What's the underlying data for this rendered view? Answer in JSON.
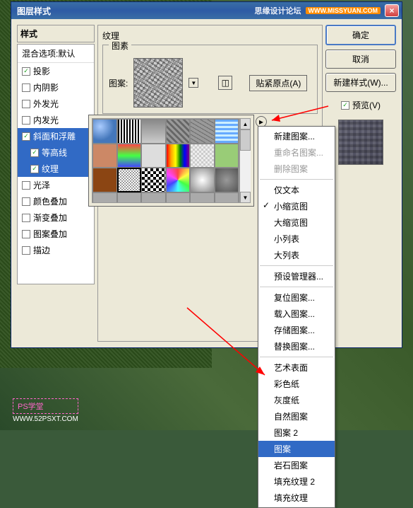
{
  "titlebar": {
    "title": "图层样式",
    "watermark_text": "思缘设计论坛",
    "watermark_url": "WWW.MISSYUAN.COM",
    "close": "×"
  },
  "styles_panel": {
    "header": "样式",
    "blend_label": "混合选项:默认",
    "items": [
      {
        "label": "投影",
        "checked": true,
        "selected": false,
        "sub": false
      },
      {
        "label": "内阴影",
        "checked": false,
        "selected": false,
        "sub": false
      },
      {
        "label": "外发光",
        "checked": false,
        "selected": false,
        "sub": false
      },
      {
        "label": "内发光",
        "checked": false,
        "selected": false,
        "sub": false
      },
      {
        "label": "斜面和浮雕",
        "checked": true,
        "selected": true,
        "sub": false
      },
      {
        "label": "等高线",
        "checked": true,
        "selected": true,
        "sub": true
      },
      {
        "label": "纹理",
        "checked": true,
        "selected": true,
        "sub": true
      },
      {
        "label": "光泽",
        "checked": false,
        "selected": false,
        "sub": false
      },
      {
        "label": "颜色叠加",
        "checked": false,
        "selected": false,
        "sub": false
      },
      {
        "label": "渐变叠加",
        "checked": false,
        "selected": false,
        "sub": false
      },
      {
        "label": "图案叠加",
        "checked": false,
        "selected": false,
        "sub": false
      },
      {
        "label": "描边",
        "checked": false,
        "selected": false,
        "sub": false
      }
    ]
  },
  "middle": {
    "section_label": "纹理",
    "fieldset_label": "图素",
    "pattern_label": "图案:",
    "snap_btn": "贴紧原点(A)"
  },
  "right": {
    "ok": "确定",
    "cancel": "取消",
    "new_style": "新建样式(W)...",
    "preview": "预览(V)"
  },
  "context_menu": {
    "groups": [
      [
        {
          "label": "新建图案...",
          "state": ""
        },
        {
          "label": "重命名图案...",
          "state": "disabled"
        },
        {
          "label": "删除图案",
          "state": "disabled"
        }
      ],
      [
        {
          "label": "仅文本",
          "state": ""
        },
        {
          "label": "小缩览图",
          "state": "checked"
        },
        {
          "label": "大缩览图",
          "state": ""
        },
        {
          "label": "小列表",
          "state": ""
        },
        {
          "label": "大列表",
          "state": ""
        }
      ],
      [
        {
          "label": "预设管理器...",
          "state": ""
        }
      ],
      [
        {
          "label": "复位图案...",
          "state": ""
        },
        {
          "label": "载入图案...",
          "state": ""
        },
        {
          "label": "存储图案...",
          "state": ""
        },
        {
          "label": "替换图案...",
          "state": ""
        }
      ],
      [
        {
          "label": "艺术表面",
          "state": ""
        },
        {
          "label": "彩色纸",
          "state": ""
        },
        {
          "label": "灰度纸",
          "state": ""
        },
        {
          "label": "自然图案",
          "state": ""
        },
        {
          "label": "图案 2",
          "state": ""
        },
        {
          "label": "图案",
          "state": "selected"
        },
        {
          "label": "岩石图案",
          "state": ""
        },
        {
          "label": "填充纹理 2",
          "state": ""
        },
        {
          "label": "填充纹理",
          "state": ""
        }
      ]
    ]
  },
  "footer": {
    "badge": "PS学堂",
    "url": "WWW.52PSXT.COM"
  },
  "flyout_glyph": "▸"
}
